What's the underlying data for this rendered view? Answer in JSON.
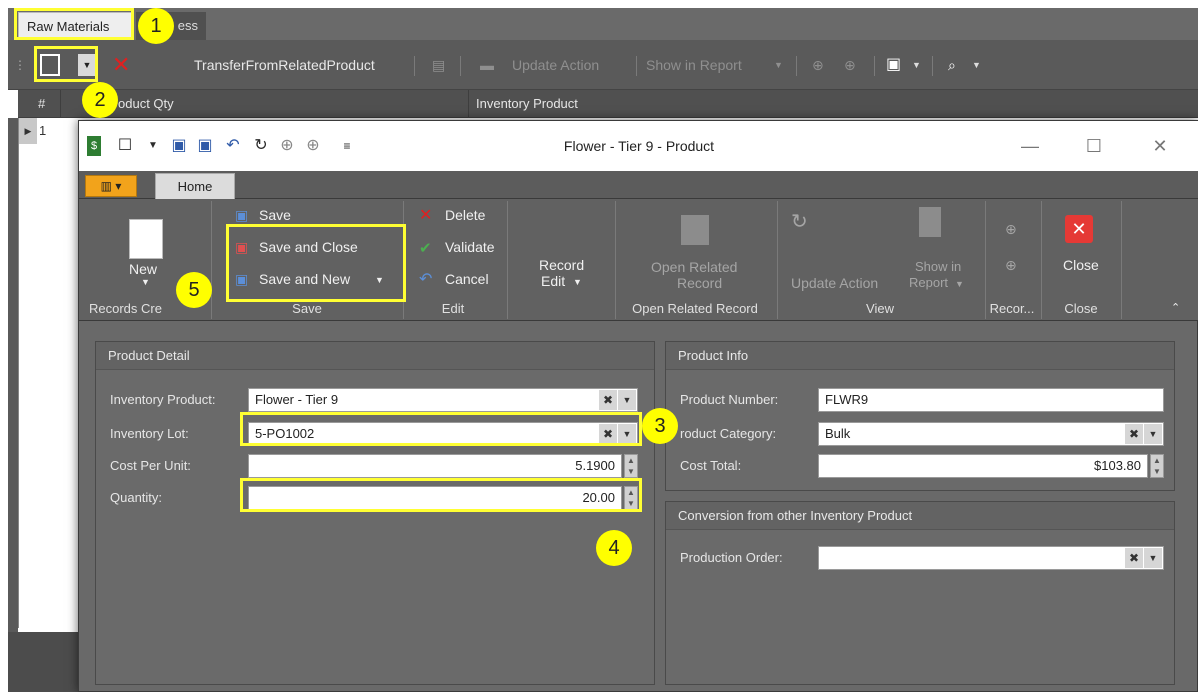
{
  "background": {
    "tabs": [
      {
        "label": "Raw Materials"
      },
      {
        "label": "ess"
      }
    ],
    "toolbar": {
      "transfer_label": "TransferFromRelatedProduct",
      "update_action_label": "Update Action",
      "show_in_report_label": "Show in Report"
    },
    "grid": {
      "columns": [
        {
          "label": "#"
        },
        {
          "label": "oduct Qty"
        },
        {
          "label": "Inventory Product"
        }
      ],
      "rows": [
        {
          "num": "1"
        }
      ]
    }
  },
  "dialog": {
    "title": "Flower - Tier 9 - Product",
    "tabs": {
      "home_label": "Home"
    },
    "ribbon": {
      "records_creation": {
        "new_label": "New",
        "group_label": "Records Cre"
      },
      "save_group": {
        "save_label": "Save",
        "save_close_label": "Save and Close",
        "save_new_label": "Save and New",
        "group_label": "Save"
      },
      "edit_group": {
        "delete_label": "Delete",
        "validate_label": "Validate",
        "cancel_label": "Cancel",
        "group_label": "Edit"
      },
      "record_edit": {
        "line1": "Record",
        "line2": "Edit"
      },
      "open_related": {
        "line1": "Open Related",
        "line2": "Record",
        "group_label": "Open Related Record"
      },
      "view_group": {
        "update_action_label": "Update Action",
        "show_in_line1": "Show in",
        "show_in_line2": "Report",
        "group_label": "View"
      },
      "record_group": {
        "group_label": "Recor..."
      },
      "close_group": {
        "close_label": "Close",
        "group_label": "Close"
      }
    },
    "product_detail": {
      "header": "Product Detail",
      "inventory_product": {
        "label": "Inventory Product:",
        "value": "Flower - Tier 9"
      },
      "inventory_lot": {
        "label": "Inventory Lot:",
        "value": "5-PO1002"
      },
      "cost_per_unit": {
        "label": "Cost Per Unit:",
        "value": "5.1900"
      },
      "quantity": {
        "label": "Quantity:",
        "value": "20.00"
      }
    },
    "product_info": {
      "header": "Product Info",
      "product_number": {
        "label": "Product Number:",
        "value": "FLWR9"
      },
      "product_category": {
        "label": "roduct Category:",
        "value": "Bulk"
      },
      "cost_total": {
        "label": "Cost Total:",
        "value": "$103.80"
      }
    },
    "conversion": {
      "header": "Conversion from other Inventory Product",
      "production_order": {
        "label": "Production Order:",
        "value": ""
      }
    }
  },
  "annotations": {
    "badges": [
      "1",
      "2",
      "3",
      "4",
      "5"
    ],
    "highlight_color": "#ffff33"
  }
}
